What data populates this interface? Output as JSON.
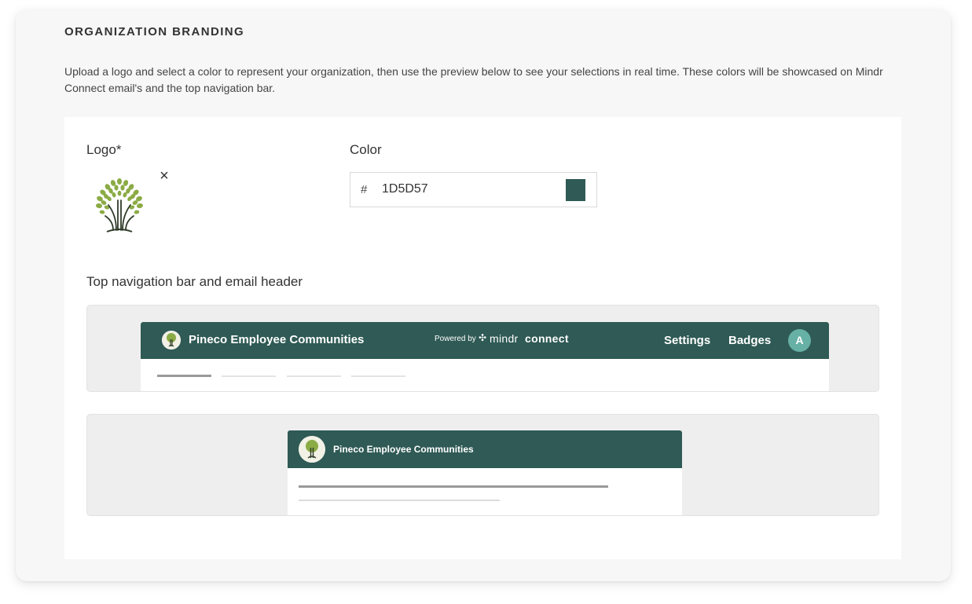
{
  "section": {
    "title": "ORGANIZATION BRANDING",
    "intro": "Upload a logo and select a color to represent your organization, then use the preview below to see your selections in real time. These colors will be showcased on Mindr Connect email's and the top navigation bar."
  },
  "logo": {
    "label": "Logo*",
    "remove_glyph": "×",
    "icon": "tree-logo-icon"
  },
  "color": {
    "label": "Color",
    "prefix": "#",
    "value": "1D5D57",
    "swatch_color": "#2f5a55"
  },
  "preview": {
    "label": "Top navigation bar and email header",
    "nav": {
      "org_name": "Pineco Employee Communities",
      "powered_by": "Powered by",
      "brand_mark": "✣",
      "brand_mindr": "mindr",
      "brand_connect": "connect",
      "settings": "Settings",
      "badges": "Badges",
      "avatar_initial": "A"
    },
    "email": {
      "org_name": "Pineco Employee Communities"
    }
  },
  "colors": {
    "brand": "#2f5a55",
    "avatar": "#67b0a6"
  }
}
